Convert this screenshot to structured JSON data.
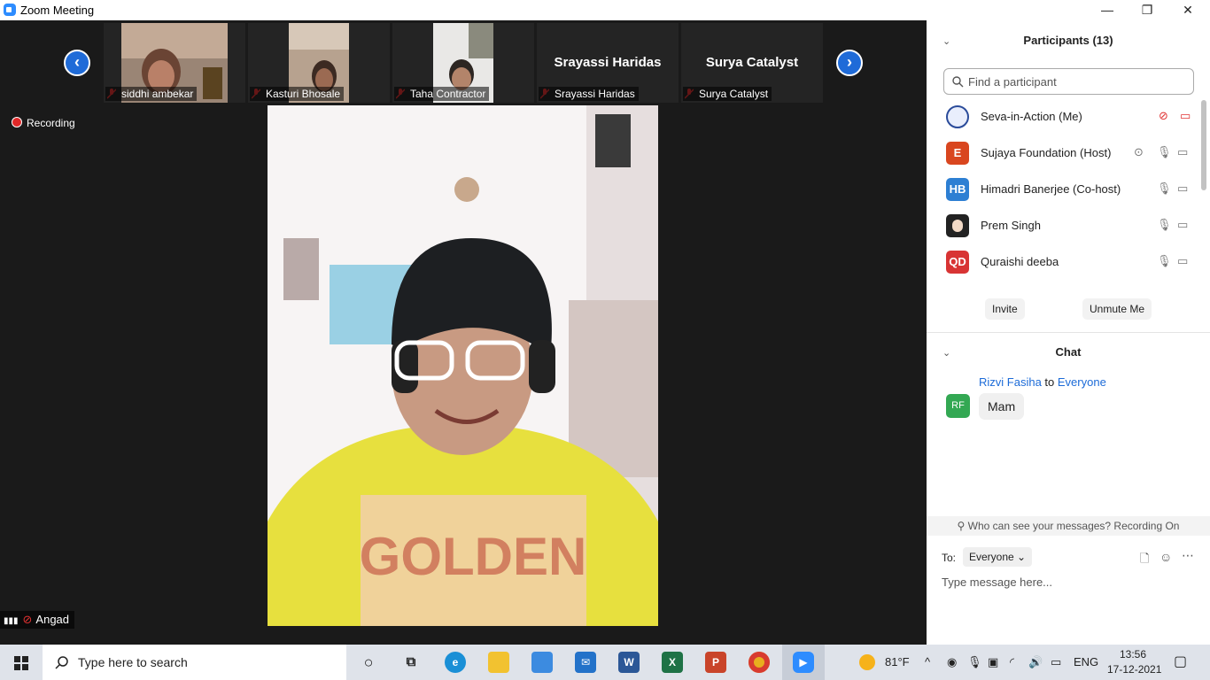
{
  "window": {
    "title": "Zoom Meeting",
    "minimize": "—",
    "maximize": "❐",
    "close": "✕"
  },
  "thumbnails": [
    {
      "name": "siddhi ambekar",
      "video": true
    },
    {
      "name": "Kasturi Bhosale",
      "video": true
    },
    {
      "name": "Taha Contractor",
      "video": true
    },
    {
      "name": "Srayassi Haridas",
      "video": false
    },
    {
      "name": "Surya Catalyst",
      "video": false
    }
  ],
  "nav": {
    "prev": "‹",
    "next": "›"
  },
  "recording_label": "Recording",
  "main_speaker": {
    "name": "Angad",
    "shirt_text": "GOLDEN"
  },
  "participants": {
    "title": "Participants (13)",
    "search_placeholder": "Find a participant",
    "list": [
      {
        "name": "Seva-in-Action (Me)",
        "initials": "",
        "color": "#e9eefc"
      },
      {
        "name": "Sujaya Foundation (Host)",
        "initials": "E",
        "color": "#d9461f"
      },
      {
        "name": "Himadri Banerjee (Co-host)",
        "initials": "HB",
        "color": "#2d7fd3"
      },
      {
        "name": "Prem Singh",
        "initials": "",
        "color": "#222222"
      },
      {
        "name": "Quraishi  deeba",
        "initials": "QD",
        "color": "#d83434"
      }
    ],
    "invite_label": "Invite",
    "unmute_label": "Unmute Me"
  },
  "chat": {
    "title": "Chat",
    "messages": [
      {
        "sender": "Rizvi Fasiha",
        "to_word": "to",
        "recipient": "Everyone",
        "initials": "RF",
        "text": "Mam"
      }
    ],
    "visibility_notice": "Who can see your messages? Recording On",
    "to_label": "To:",
    "to_value": "Everyone",
    "input_placeholder": "Type message here..."
  },
  "taskbar": {
    "search_text": "Type here to search",
    "weather": "81°F",
    "language": "ENG",
    "time": "13:56",
    "date": "17-12-2021"
  }
}
